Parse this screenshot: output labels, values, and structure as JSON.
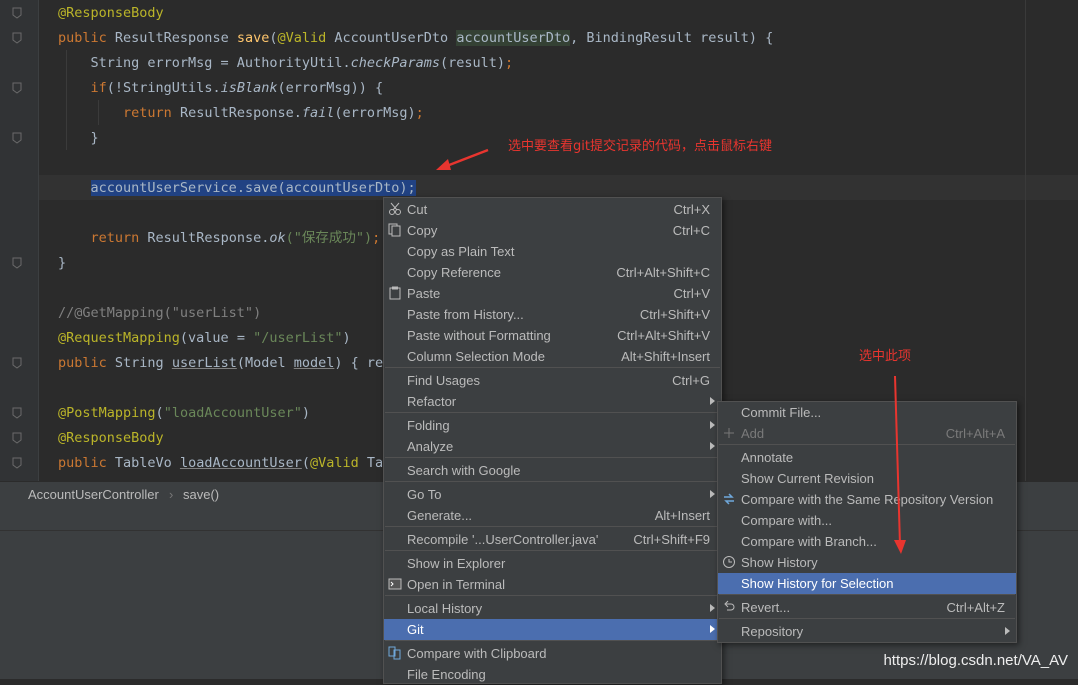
{
  "editor": {
    "lines": [
      {
        "parts": [
          {
            "t": "@ResponseBody",
            "c": "an"
          }
        ]
      },
      {
        "parts": [
          {
            "t": "public ",
            "c": "kw"
          },
          {
            "t": "ResultResponse "
          },
          {
            "t": "save",
            "c": "mt"
          },
          {
            "t": "("
          },
          {
            "t": "@Valid ",
            "c": "an"
          },
          {
            "t": "AccountUserDto "
          },
          {
            "t": "accountUserDto",
            "c": "hlvar"
          },
          {
            "t": ", BindingResult result) {"
          }
        ]
      },
      {
        "parts": [
          {
            "t": "    String errorMsg = AuthorityUtil."
          },
          {
            "t": "checkParams",
            "c": "it"
          },
          {
            "t": "(result)"
          },
          {
            "t": ";",
            "c": "kw"
          }
        ]
      },
      {
        "parts": [
          {
            "t": "    "
          },
          {
            "t": "if",
            "c": "kw"
          },
          {
            "t": "(!StringUtils."
          },
          {
            "t": "isBlank",
            "c": "it"
          },
          {
            "t": "(errorMsg)) {"
          }
        ]
      },
      {
        "parts": [
          {
            "t": "        "
          },
          {
            "t": "return ",
            "c": "kw"
          },
          {
            "t": "ResultResponse."
          },
          {
            "t": "fail",
            "c": "it"
          },
          {
            "t": "(errorMsg)"
          },
          {
            "t": ";",
            "c": "kw"
          }
        ]
      },
      {
        "parts": [
          {
            "t": "    }"
          }
        ]
      },
      {
        "parts": [
          {
            "t": ""
          }
        ]
      },
      {
        "parts": [
          {
            "t": "    "
          },
          {
            "t": "accountUserService.save(accountUserDto);",
            "c": "sel"
          }
        ]
      },
      {
        "parts": [
          {
            "t": ""
          }
        ]
      },
      {
        "parts": [
          {
            "t": "    "
          },
          {
            "t": "return ",
            "c": "kw"
          },
          {
            "t": "ResultResponse."
          },
          {
            "t": "ok",
            "c": "it"
          },
          {
            "t": "(\"保存成功\")",
            "c": "st"
          },
          {
            "t": ";",
            "c": "kw"
          }
        ]
      },
      {
        "parts": [
          {
            "t": "}"
          }
        ]
      },
      {
        "parts": [
          {
            "t": ""
          }
        ]
      },
      {
        "parts": [
          {
            "t": "//@GetMapping(\"userList\")",
            "c": "cm"
          }
        ]
      },
      {
        "parts": [
          {
            "t": "@RequestMapping",
            "c": "an"
          },
          {
            "t": "(value = "
          },
          {
            "t": "\"/userList\"",
            "c": "st"
          },
          {
            "t": ")"
          }
        ]
      },
      {
        "parts": [
          {
            "t": "public ",
            "c": "kw"
          },
          {
            "t": "String "
          },
          {
            "t": "userList",
            "c": "mtul"
          },
          {
            "t": "(Model "
          },
          {
            "t": "model",
            "c": "ul"
          },
          {
            "t": ") { ret"
          }
        ]
      },
      {
        "parts": [
          {
            "t": ""
          }
        ]
      },
      {
        "parts": [
          {
            "t": "@PostMapping",
            "c": "an"
          },
          {
            "t": "("
          },
          {
            "t": "\"loadAccountUser\"",
            "c": "st"
          },
          {
            "t": ")"
          }
        ]
      },
      {
        "parts": [
          {
            "t": "@ResponseBody",
            "c": "an"
          }
        ]
      },
      {
        "parts": [
          {
            "t": "public ",
            "c": "kw"
          },
          {
            "t": "TableVo "
          },
          {
            "t": "loadAccountUser",
            "c": "mtul"
          },
          {
            "t": "("
          },
          {
            "t": "@Valid ",
            "c": "an"
          },
          {
            "t": "Tab"
          }
        ]
      }
    ]
  },
  "breadcrumb": {
    "class_name": "AccountUserController",
    "separator": "›",
    "method_name": "save()"
  },
  "context_menu": {
    "items": [
      {
        "label": "Cut",
        "shortcut": "Ctrl+X",
        "icon": "scissors-icon"
      },
      {
        "label": "Copy",
        "shortcut": "Ctrl+C",
        "icon": "copy-icon"
      },
      {
        "label": "Copy as Plain Text",
        "shortcut": ""
      },
      {
        "label": "Copy Reference",
        "shortcut": "Ctrl+Alt+Shift+C"
      },
      {
        "label": "Paste",
        "shortcut": "Ctrl+V",
        "icon": "paste-icon"
      },
      {
        "label": "Paste from History...",
        "shortcut": "Ctrl+Shift+V"
      },
      {
        "label": "Paste without Formatting",
        "shortcut": "Ctrl+Alt+Shift+V"
      },
      {
        "label": "Column Selection Mode",
        "shortcut": "Alt+Shift+Insert"
      },
      {
        "label": "Find Usages",
        "shortcut": "Ctrl+G"
      },
      {
        "label": "Refactor",
        "submenu": true
      },
      {
        "label": "Folding",
        "submenu": true
      },
      {
        "label": "Analyze",
        "submenu": true
      },
      {
        "label": "Search with Google",
        "shortcut": ""
      },
      {
        "label": "Go To",
        "submenu": true
      },
      {
        "label": "Generate...",
        "shortcut": "Alt+Insert"
      },
      {
        "label": "Recompile '...UserController.java'",
        "shortcut": "Ctrl+Shift+F9"
      },
      {
        "label": "Show in Explorer",
        "shortcut": ""
      },
      {
        "label": "Open in Terminal",
        "shortcut": "",
        "icon": "terminal-icon"
      },
      {
        "label": "Local History",
        "submenu": true
      },
      {
        "label": "Git",
        "submenu": true,
        "highlighted": true
      },
      {
        "label": "Compare with Clipboard",
        "shortcut": "",
        "icon": "compare-icon"
      },
      {
        "label": "File Encoding",
        "shortcut": ""
      }
    ]
  },
  "git_submenu": {
    "items": [
      {
        "label": "Commit File...",
        "shortcut": ""
      },
      {
        "label": "Add",
        "shortcut": "Ctrl+Alt+A",
        "disabled": true,
        "icon": "plus-icon"
      },
      {
        "label": "Annotate",
        "shortcut": ""
      },
      {
        "label": "Show Current Revision",
        "shortcut": ""
      },
      {
        "label": "Compare with the Same Repository Version",
        "shortcut": "",
        "icon": "compare-arrows-icon"
      },
      {
        "label": "Compare with...",
        "shortcut": ""
      },
      {
        "label": "Compare with Branch...",
        "shortcut": ""
      },
      {
        "label": "Show History",
        "shortcut": "",
        "icon": "clock-icon"
      },
      {
        "label": "Show History for Selection",
        "shortcut": "",
        "highlighted": true
      },
      {
        "label": "Revert...",
        "shortcut": "Ctrl+Alt+Z",
        "icon": "revert-icon"
      },
      {
        "label": "Repository",
        "submenu": true
      }
    ]
  },
  "annotations": {
    "note_1": "选中要查看git提交记录的代码，点击鼠标右键",
    "note_2": "选中此项"
  },
  "watermark": "https://blog.csdn.net/VA_AV",
  "colors": {
    "annotation": "#e8352f",
    "highlight": "#4b6eaf",
    "selection": "#214283"
  }
}
